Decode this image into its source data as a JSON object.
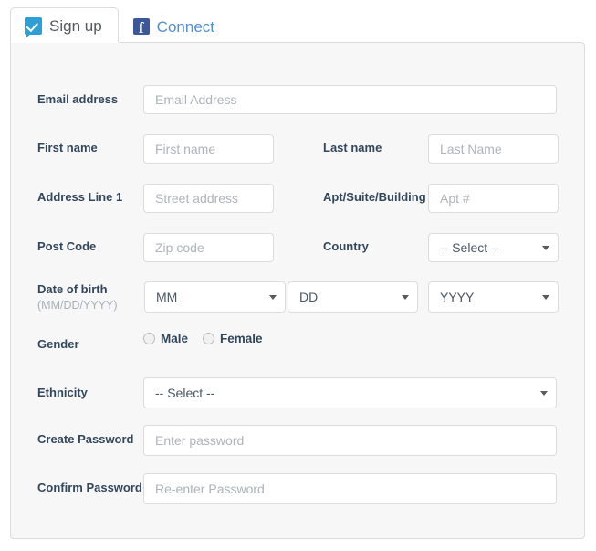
{
  "tabs": [
    {
      "label": "Sign up",
      "icon": "signup-check-bubble-icon",
      "active": true
    },
    {
      "label": "Connect",
      "icon": "facebook-icon",
      "active": false
    }
  ],
  "colors": {
    "panel_bg": "#f7f7f8",
    "border": "#dcdcdc",
    "label": "#33475b",
    "placeholder": "#aeb4ba",
    "link_blue": "#4f8fd4",
    "signup_icon_blue": "#2e9fd4",
    "facebook_blue": "#3b5998"
  },
  "form": {
    "email": {
      "label": "Email address",
      "placeholder": "Email Address",
      "value": ""
    },
    "first_name": {
      "label": "First name",
      "placeholder": "First name",
      "value": ""
    },
    "last_name": {
      "label": "Last name",
      "placeholder": "Last Name",
      "value": ""
    },
    "address_line1": {
      "label": "Address Line 1",
      "placeholder": "Street address",
      "value": ""
    },
    "apt": {
      "label": "Apt/Suite/Building",
      "placeholder": "Apt #",
      "value": ""
    },
    "post_code": {
      "label": "Post Code",
      "placeholder": "Zip code",
      "value": ""
    },
    "country": {
      "label": "Country",
      "selected": "-- Select --"
    },
    "dob": {
      "label": "Date of birth",
      "sub_label": "(MM/DD/YYYY)",
      "month": "MM",
      "day": "DD",
      "year": "YYYY"
    },
    "gender": {
      "label": "Gender",
      "options": [
        {
          "label": "Male",
          "selected": false
        },
        {
          "label": "Female",
          "selected": false
        }
      ]
    },
    "ethnicity": {
      "label": "Ethnicity",
      "selected": "-- Select --"
    },
    "create_password": {
      "label": "Create Password",
      "placeholder": "Enter password",
      "value": ""
    },
    "confirm_password": {
      "label": "Confirm Password",
      "placeholder": "Re-enter Password",
      "value": ""
    }
  }
}
